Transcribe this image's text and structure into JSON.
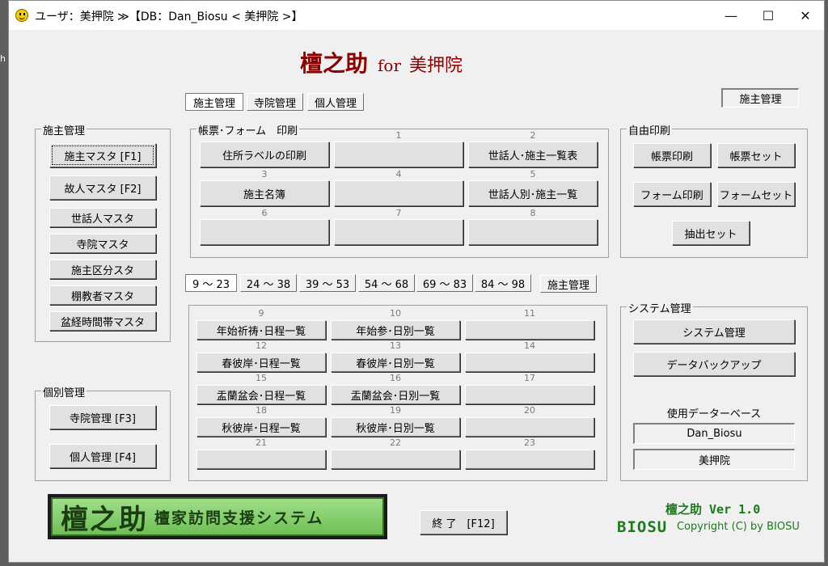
{
  "window": {
    "title": "ユーザ：美押院 ≫【DB：Dan_Biosu < 美押院 >】",
    "min": "—",
    "max": "☐",
    "close": "✕"
  },
  "edge_text": "h",
  "app_title": {
    "main": "檀之助",
    "for": "for",
    "temple": "美押院"
  },
  "top_tabs": [
    "施主管理",
    "寺院管理",
    "個人管理"
  ],
  "mode_label": "施主管理",
  "left_group": {
    "title": "施主管理",
    "buttons": [
      "施主マスタ [F1]",
      "故人マスタ [F2]",
      "世話人マスタ",
      "寺院マスタ",
      "施主区分スタ",
      "棚教者マスタ",
      "盆経時間帯マスタ"
    ]
  },
  "personal_group": {
    "title": "個別管理",
    "buttons": [
      "寺院管理 [F3]",
      "個人管理 [F4]"
    ]
  },
  "forms_group": {
    "title": "帳票･フォーム　印刷",
    "cells": [
      {
        "num": "",
        "label": "住所ラベルの印刷"
      },
      {
        "num": "1",
        "label": ""
      },
      {
        "num": "2",
        "label": "世話人･施主一覧表"
      },
      {
        "num": "3",
        "label": "施主名簿"
      },
      {
        "num": "4",
        "label": ""
      },
      {
        "num": "5",
        "label": "世話人別･施主一覧"
      },
      {
        "num": "6",
        "label": ""
      },
      {
        "num": "7",
        "label": ""
      },
      {
        "num": "8",
        "label": ""
      }
    ]
  },
  "free_print": {
    "title": "自由印刷",
    "buttons": [
      "帳票印刷",
      "帳票セット",
      "フォーム印刷",
      "フォームセット",
      "抽出セット"
    ]
  },
  "range_tabs": [
    "9 ～ 23",
    "24 ～ 38",
    "39 ～ 53",
    "54 ～ 68",
    "69 ～ 83",
    "84 ～ 98"
  ],
  "range_mode_label": "施主管理",
  "grid2": {
    "cells": [
      {
        "num": "9",
        "label": "年始祈祷･日程一覧"
      },
      {
        "num": "10",
        "label": "年始参･日別一覧"
      },
      {
        "num": "11",
        "label": ""
      },
      {
        "num": "12",
        "label": "春彼岸･日程一覧"
      },
      {
        "num": "13",
        "label": "春彼岸･日別一覧"
      },
      {
        "num": "14",
        "label": ""
      },
      {
        "num": "15",
        "label": "盂蘭盆会･日程一覧"
      },
      {
        "num": "16",
        "label": "盂蘭盆会･日別一覧"
      },
      {
        "num": "17",
        "label": ""
      },
      {
        "num": "18",
        "label": "秋彼岸･日程一覧"
      },
      {
        "num": "19",
        "label": "秋彼岸･日別一覧"
      },
      {
        "num": "20",
        "label": ""
      },
      {
        "num": "21",
        "label": ""
      },
      {
        "num": "22",
        "label": ""
      },
      {
        "num": "23",
        "label": ""
      }
    ]
  },
  "system_group": {
    "title": "システム管理",
    "buttons": [
      "システム管理",
      "データバックアップ"
    ],
    "db_label": "使用データーベース",
    "db_name": "Dan_Biosu",
    "db_temple": "美押院"
  },
  "logo": {
    "main": "檀之助",
    "sub": "檀家訪問支援システム"
  },
  "exit_button": "終 了　[F12]",
  "version": "檀之助 Ver 1.0",
  "brand": "BIOSU",
  "copyright": "Copyright (C) by BIOSU"
}
